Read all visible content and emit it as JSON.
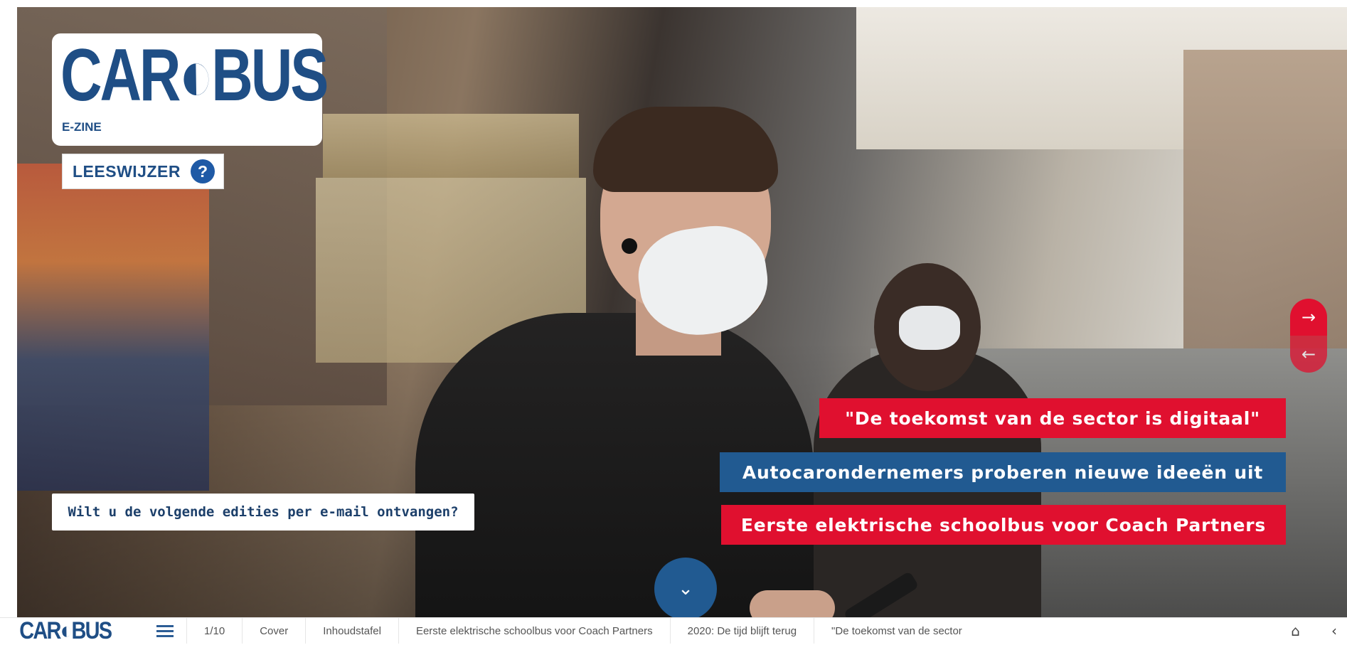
{
  "brand": {
    "logo_text": "CAR◐BUS",
    "logo_subtitle": "E-ZINE",
    "nav_logo_text": "CAR◐BUS",
    "primary_color": "#1f4e85",
    "accent_red": "#e0102f",
    "accent_blue": "#215a91"
  },
  "hero": {
    "reading_guide_label": "LEESWIJZER",
    "help_icon_glyph": "?",
    "subscribe_text": "Wilt u de volgende edities per e-mail ontvangen?",
    "headlines": [
      {
        "text": "\"De toekomst van de sector is digitaal\"",
        "color": "#e0102f"
      },
      {
        "text": "Autocarondernemers proberen nieuwe ideeën uit",
        "color": "#215a91"
      },
      {
        "text": "Eerste elektrische schoolbus voor Coach Partners",
        "color": "#e0102f"
      }
    ],
    "next_arrow_glyph": "→",
    "prev_arrow_glyph": "←",
    "scroll_down_glyph": "⌄"
  },
  "bottom_nav": {
    "items": [
      "1/10",
      "Cover",
      "Inhoudstafel",
      "Eerste elektrische schoolbus voor Coach Partners",
      "2020: De tijd blijft terug",
      "\"De toekomst van de sector"
    ],
    "search_glyph": "⌂",
    "expand_glyph": "‹"
  }
}
